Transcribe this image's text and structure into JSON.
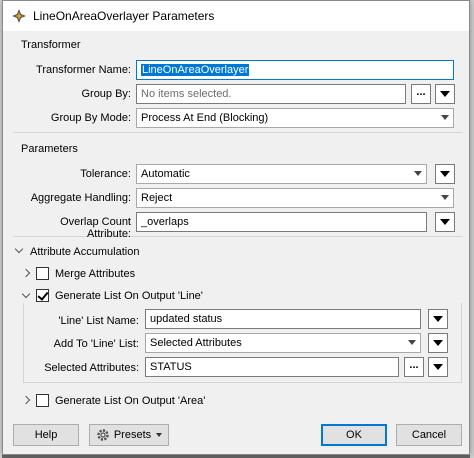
{
  "window": {
    "title": "LineOnAreaOverlayer Parameters"
  },
  "transformer": {
    "section_label": "Transformer",
    "name_label": "Transformer Name:",
    "name_value": "LineOnAreaOverlayer",
    "group_by_label": "Group By:",
    "group_by_placeholder": "No items selected.",
    "group_by_button": "...",
    "group_by_mode_label": "Group By Mode:",
    "group_by_mode_value": "Process At End (Blocking)"
  },
  "parameters": {
    "section_label": "Parameters",
    "tolerance_label": "Tolerance:",
    "tolerance_value": "Automatic",
    "aggregate_label": "Aggregate Handling:",
    "aggregate_value": "Reject",
    "overlap_label": "Overlap Count Attribute:",
    "overlap_value": "_overlaps"
  },
  "accumulation": {
    "section_label": "Attribute Accumulation",
    "merge_label": "Merge Attributes",
    "merge_checked": false,
    "line_list_label": "Generate List On Output 'Line'",
    "line_list_checked": true,
    "line_list_name_label": "'Line' List Name:",
    "line_list_name_value": "updated status",
    "add_to_label": "Add To 'Line' List:",
    "add_to_value": "Selected Attributes",
    "selected_attrs_label": "Selected Attributes:",
    "selected_attrs_value": "STATUS",
    "selected_attrs_button": "...",
    "area_list_label": "Generate List On Output 'Area'",
    "area_list_checked": false
  },
  "footer": {
    "help": "Help",
    "presets": "Presets",
    "ok": "OK",
    "cancel": "Cancel"
  },
  "colors": {
    "accent": "#0078d7",
    "panel": "#f0f0f0"
  },
  "icons": [
    "fme-transformer-icon",
    "gear-icon",
    "dropdown-arrow-icon",
    "expand-chevron-icon"
  ]
}
